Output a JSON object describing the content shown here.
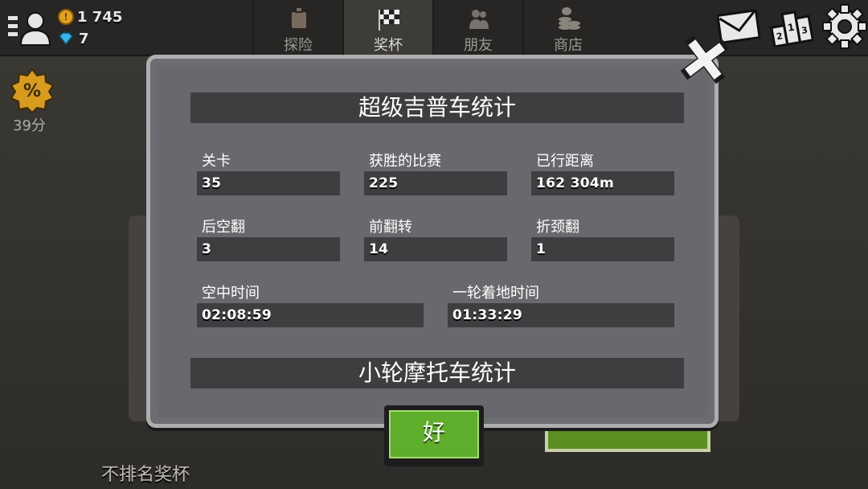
{
  "header": {
    "coins": "1 745",
    "gems": "7",
    "tabs": [
      {
        "label": "探险",
        "icon": "fuel-can-icon",
        "active": false
      },
      {
        "label": "奖杯",
        "icon": "checkered-flag-icon",
        "active": true
      },
      {
        "label": "朋友",
        "icon": "friends-icon",
        "active": false
      },
      {
        "label": "商店",
        "icon": "coin-stack-icon",
        "active": false
      }
    ],
    "right_icons": [
      "mail-icon",
      "leaderboard-icon",
      "settings-gear-icon"
    ]
  },
  "side": {
    "percent_label": "39分"
  },
  "background": {
    "bottom_text": "不排名奖杯"
  },
  "modal": {
    "section1": {
      "title": "超级吉普车统计",
      "stats": [
        {
          "label": "关卡",
          "value": "35"
        },
        {
          "label": "获胜的比赛",
          "value": "225"
        },
        {
          "label": "已行距离",
          "value": "162 304m"
        },
        {
          "label": "后空翻",
          "value": "3"
        },
        {
          "label": "前翻转",
          "value": "14"
        },
        {
          "label": "折颈翻",
          "value": "1"
        },
        {
          "label": "空中时间",
          "value": "02:08:59"
        },
        {
          "label": "一轮着地时间",
          "value": "01:33:29"
        }
      ]
    },
    "section2": {
      "title": "小轮摩托车统计"
    },
    "ok_label": "好"
  },
  "colors": {
    "modal_bg": "#6b6d70",
    "value_bg": "#3d3e40",
    "ok_green": "#5fae2b"
  }
}
